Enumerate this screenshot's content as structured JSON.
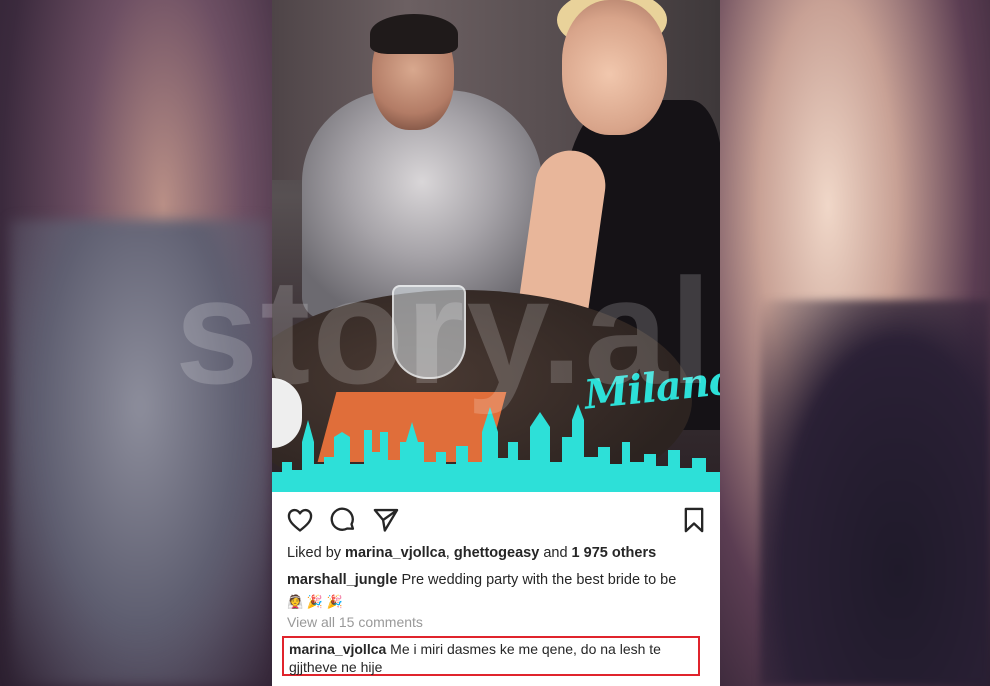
{
  "post": {
    "image_overlay_text": "Milano",
    "watermark": "story.al",
    "likes": {
      "prefix": "Liked by",
      "user1": "marina_vjollca",
      "separator": ",",
      "user2": "ghettogeasy",
      "and": "and",
      "count": "1 975 others"
    },
    "caption": {
      "user": "marshall_jungle",
      "text": "Pre wedding party with the best bride to be",
      "emojis": "👰 🎉 🎉"
    },
    "view_comments": "View all 15 comments",
    "highlighted_comment": {
      "user": "marina_vjollca",
      "text": "Me i miri dasmes ke me qene, do na lesh te gjjtheve ne hije"
    },
    "icons": {
      "like": "heart-icon",
      "comment": "comment-icon",
      "share": "send-icon",
      "save": "bookmark-icon"
    },
    "colors": {
      "milano_text": "#2de0d8",
      "skyline": "#2de0d8",
      "highlight_border": "#e0242c"
    }
  }
}
